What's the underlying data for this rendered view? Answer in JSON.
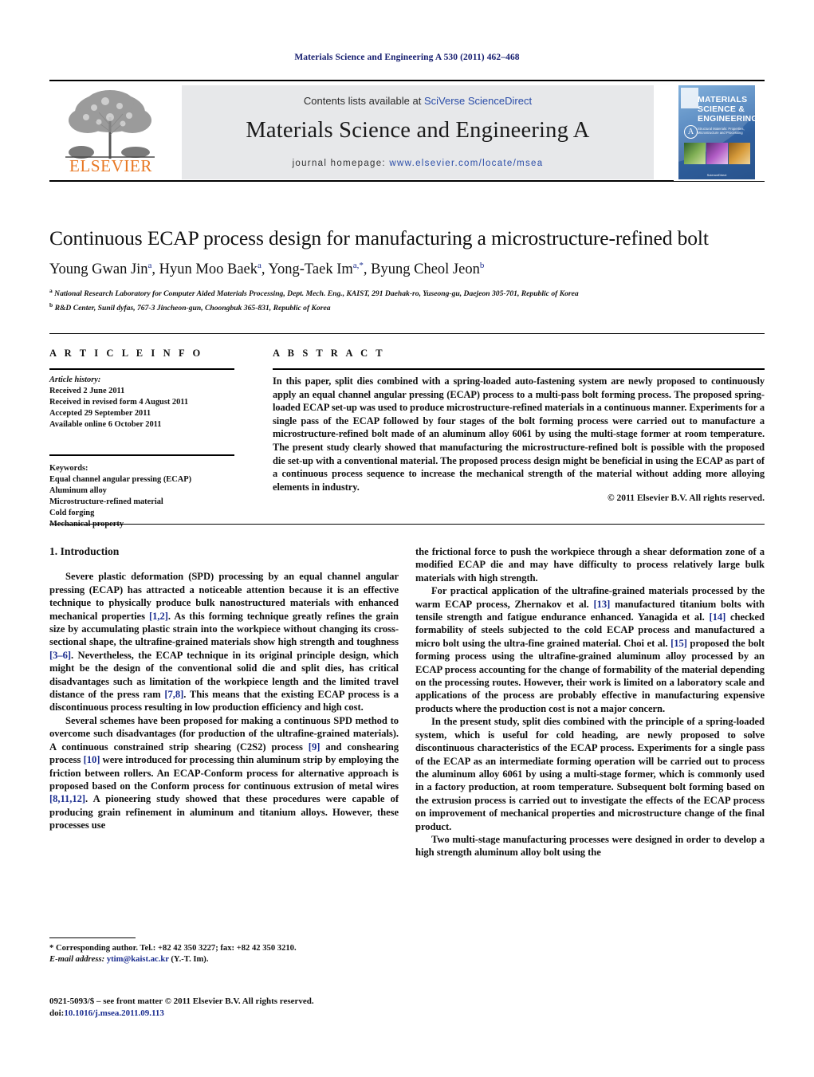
{
  "running_head": "Materials Science and Engineering A 530 (2011) 462–468",
  "masthead": {
    "contents_prefix": "Contents lists available at ",
    "contents_link": "SciVerse ScienceDirect",
    "journal_name": "Materials Science and Engineering A",
    "homepage_prefix": "journal homepage: ",
    "homepage_url": "www.elsevier.com/locate/msea",
    "publisher_wordmark": "ELSEVIER",
    "cover": {
      "title_line1": "MATERIALS",
      "title_line2": "SCIENCE &",
      "title_line3": "ENGINEERING",
      "badge": "A",
      "subtitle": "Structural Materials: Properties, Microstructure and Processing",
      "footer": "ScienceDirect"
    }
  },
  "article": {
    "title": "Continuous ECAP process design for manufacturing a microstructure-refined bolt",
    "authors": [
      {
        "name": "Young Gwan Jin",
        "marks": "a"
      },
      {
        "name": "Hyun Moo Baek",
        "marks": "a"
      },
      {
        "name": "Yong-Taek Im",
        "marks": "a,*"
      },
      {
        "name": "Byung Cheol Jeon",
        "marks": "b"
      }
    ],
    "affiliations": [
      {
        "mark": "a",
        "text": "National Research Laboratory for Computer Aided Materials Processing, Dept. Mech. Eng., KAIST, 291 Daehak-ro, Yuseong-gu, Daejeon 305-701, Republic of Korea"
      },
      {
        "mark": "b",
        "text": "R&D Center, Sunil dyfas, 767-3 Jincheon-gun, Choongbuk 365-831, Republic of Korea"
      }
    ]
  },
  "info_panel": {
    "info_heading": "A R T I C L E  I N F O",
    "abstract_heading": "A B S T R A C T",
    "history_label": "Article history:",
    "history": [
      "Received 2 June 2011",
      "Received in revised form 4 August 2011",
      "Accepted 29 September 2011",
      "Available online 6 October 2011"
    ],
    "keywords_label": "Keywords:",
    "keywords": [
      "Equal channel angular pressing (ECAP)",
      "Aluminum alloy",
      "Microstructure-refined material",
      "Cold forging",
      "Mechanical property"
    ],
    "abstract": "In this paper, split dies combined with a spring-loaded auto-fastening system are newly proposed to continuously apply an equal channel angular pressing (ECAP) process to a multi-pass bolt forming process. The proposed spring-loaded ECAP set-up was used to produce microstructure-refined materials in a continuous manner. Experiments for a single pass of the ECAP followed by four stages of the bolt forming process were carried out to manufacture a microstructure-refined bolt made of an aluminum alloy 6061 by using the multi-stage former at room temperature. The present study clearly showed that manufacturing the microstructure-refined bolt is possible with the proposed die set-up with a conventional material. The proposed process design might be beneficial in using the ECAP as part of a continuous process sequence to increase the mechanical strength of the material without adding more alloying elements in industry.",
    "copyright": "© 2011 Elsevier B.V. All rights reserved."
  },
  "body": {
    "section_title": "1.  Introduction",
    "left_paragraphs": [
      {
        "segments": [
          {
            "t": "Severe plastic deformation (SPD) processing by an equal channel angular pressing (ECAP) has attracted a noticeable attention because it is an effective technique to physically produce bulk nanostructured materials with enhanced mechanical properties ",
            "cite": false
          },
          {
            "t": "[1,2]",
            "cite": true
          },
          {
            "t": ". As this forming technique greatly refines the grain size by accumulating plastic strain into the workpiece without changing its cross-sectional shape, the ultrafine-grained materials show high strength and toughness ",
            "cite": false
          },
          {
            "t": "[3–6]",
            "cite": true
          },
          {
            "t": ". Nevertheless, the ECAP technique in its original principle design, which might be the design of the conventional solid die and split dies, has critical disadvantages such as limitation of the workpiece length and the limited travel distance of the press ram ",
            "cite": false
          },
          {
            "t": "[7,8]",
            "cite": true
          },
          {
            "t": ". This means that the existing ECAP process is a discontinuous process resulting in low production efficiency and high cost.",
            "cite": false
          }
        ]
      },
      {
        "segments": [
          {
            "t": "Several schemes have been proposed for making a continuous SPD method to overcome such disadvantages (for production of the ultrafine-grained materials). A continuous constrained strip shearing (C2S2) process ",
            "cite": false
          },
          {
            "t": "[9]",
            "cite": true
          },
          {
            "t": " and conshearing process ",
            "cite": false
          },
          {
            "t": "[10]",
            "cite": true
          },
          {
            "t": " were introduced for processing thin aluminum strip by employing the friction between rollers. An ECAP-Conform process for alternative approach is proposed based on the Conform process for continuous extrusion of metal wires ",
            "cite": false
          },
          {
            "t": "[8,11,12]",
            "cite": true
          },
          {
            "t": ". A pioneering study showed that these procedures were capable of producing grain refinement in aluminum and titanium alloys. However, these processes use",
            "cite": false
          }
        ]
      }
    ],
    "right_paragraphs": [
      {
        "no_indent": true,
        "segments": [
          {
            "t": "the frictional force to push the workpiece through a shear deformation zone of a modified ECAP die and may have difficulty to process relatively large bulk materials with high strength.",
            "cite": false
          }
        ]
      },
      {
        "segments": [
          {
            "t": "For practical application of the ultrafine-grained materials processed by the warm ECAP process, Zhernakov et al. ",
            "cite": false
          },
          {
            "t": "[13]",
            "cite": true
          },
          {
            "t": " manufactured titanium bolts with tensile strength and fatigue endurance enhanced. Yanagida et al. ",
            "cite": false
          },
          {
            "t": "[14]",
            "cite": true
          },
          {
            "t": " checked formability of steels subjected to the cold ECAP process and manufactured a micro bolt using the ultra-fine grained material. Choi et al. ",
            "cite": false
          },
          {
            "t": "[15]",
            "cite": true
          },
          {
            "t": " proposed the bolt forming process using the ultrafine-grained aluminum alloy processed by an ECAP process accounting for the change of formability of the material depending on the processing routes. However, their work is limited on a laboratory scale and applications of the process are probably effective in manufacturing expensive products where the production cost is not a major concern.",
            "cite": false
          }
        ]
      },
      {
        "segments": [
          {
            "t": "In the present study, split dies combined with the principle of a spring-loaded system, which is useful for cold heading, are newly proposed to solve discontinuous characteristics of the ECAP process. Experiments for a single pass of the ECAP as an intermediate forming operation will be carried out to process the aluminum alloy 6061 by using a multi-stage former, which is commonly used in a factory production, at room temperature. Subsequent bolt forming based on the extrusion process is carried out to investigate the effects of the ECAP process on improvement of mechanical properties and microstructure change of the final product.",
            "cite": false
          }
        ]
      },
      {
        "segments": [
          {
            "t": "Two multi-stage manufacturing processes were designed in order to develop a high strength aluminum alloy bolt using the",
            "cite": false
          }
        ]
      }
    ]
  },
  "footnote": {
    "corresponding": "* Corresponding author. Tel.: +82 42 350 3227; fax: +82 42 350 3210.",
    "email_label": "E-mail address:",
    "email": "ytim@kaist.ac.kr",
    "email_suffix": "(Y.-T. Im).",
    "imprint": "0921-5093/$ – see front matter © 2011 Elsevier B.V. All rights reserved.",
    "doi_prefix": "doi:",
    "doi": "10.1016/j.msea.2011.09.113"
  }
}
